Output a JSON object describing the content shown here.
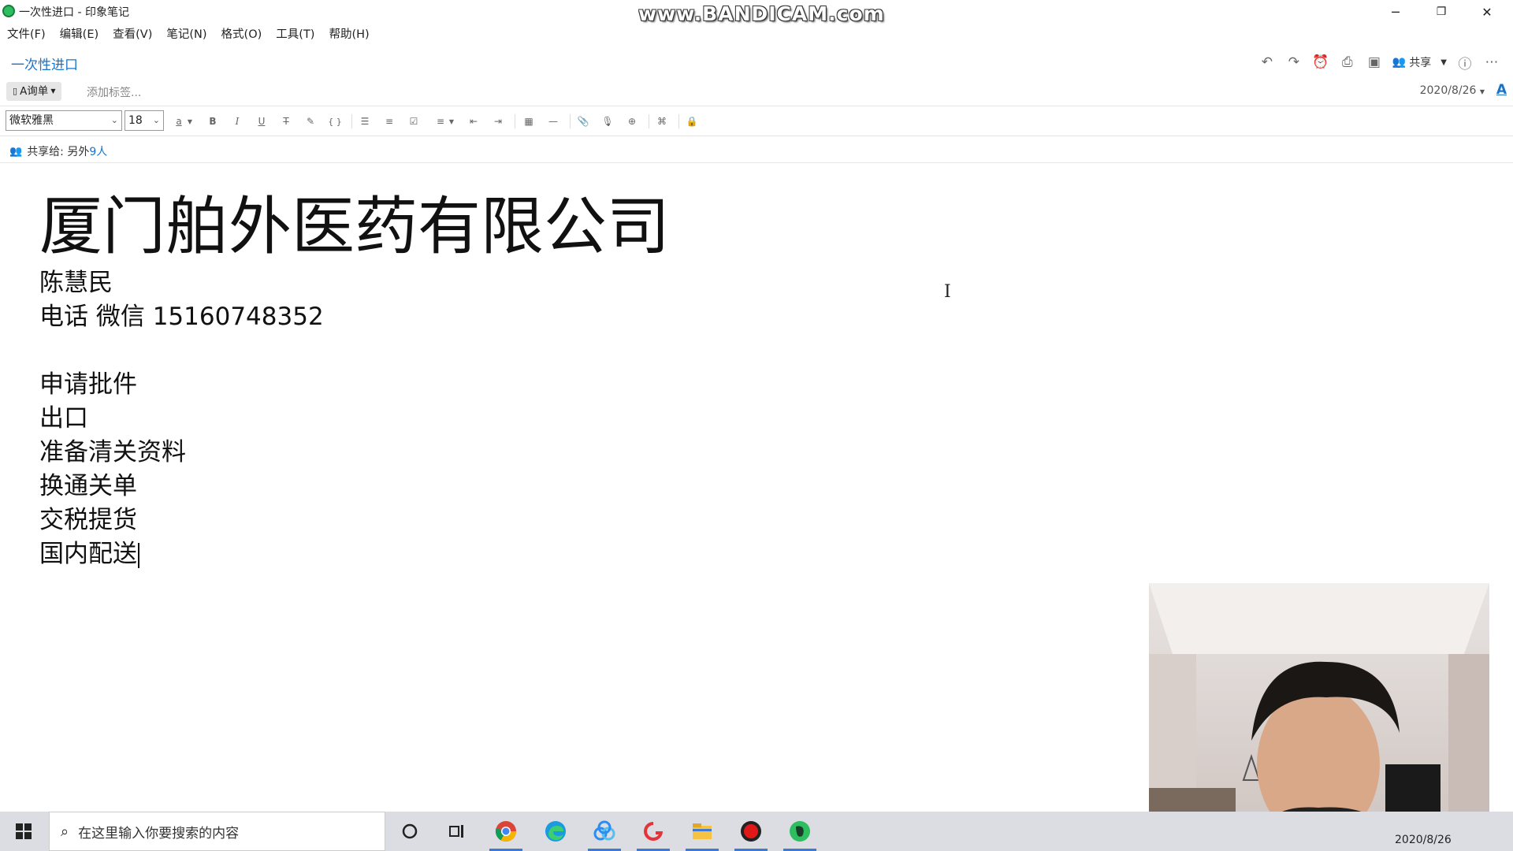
{
  "window": {
    "title": "一次性进口 - 印象笔记",
    "watermark": "www.BANDICAM.com",
    "controls": {
      "minimize": "─",
      "restore": "❐",
      "close": "✕"
    }
  },
  "menu": [
    "文件(F)",
    "编辑(E)",
    "查看(V)",
    "笔记(N)",
    "格式(O)",
    "工具(T)",
    "帮助(H)"
  ],
  "note": {
    "title": "一次性进口",
    "notebook": "A询单",
    "tag_placeholder": "添加标签...",
    "date": "2020/8/26",
    "share_button": "共享",
    "font_color_letter": "A"
  },
  "toolbar": {
    "font": "微软雅黑",
    "size": "18",
    "color_letter": "a",
    "bold": "B",
    "italic": "I",
    "underline": "U",
    "strike": "T"
  },
  "share_row": {
    "label": "共享给: 另外",
    "count": "9人"
  },
  "content": {
    "heading": "厦门舶外医药有限公司",
    "lines": [
      "陈慧民",
      "电话 微信 15160748352",
      "",
      "申请批件",
      "出口",
      "准备清关资料",
      "换通关单",
      "交税提货",
      "国内配送"
    ]
  },
  "taskbar": {
    "search_placeholder": "在这里输入你要搜索的内容",
    "date": "2020/8/26",
    "apps": [
      "cortana-icon",
      "task-view-icon",
      "chrome-icon",
      "edge-icon",
      "baidu-netdisk-icon",
      "xunlei-icon",
      "file-explorer-icon",
      "bandicam-icon",
      "evernote-icon"
    ]
  },
  "colors": {
    "accent": "#1a73c8",
    "evernote_green": "#2dbe60",
    "taskbar": "#dcdde2"
  }
}
